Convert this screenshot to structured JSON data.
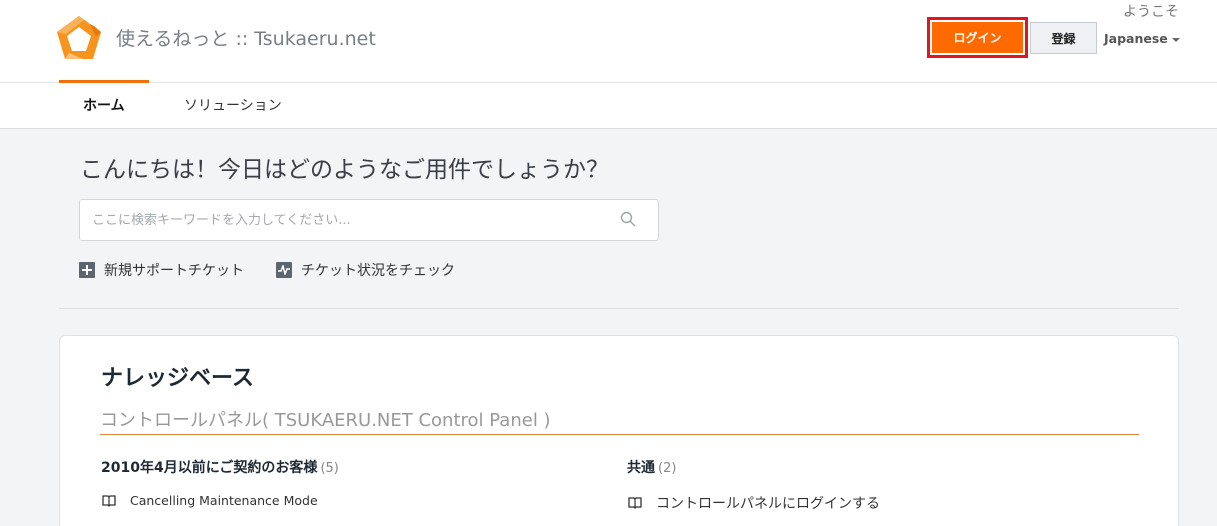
{
  "header": {
    "site_title": "使えるねっと :: Tsukaeru.net",
    "welcome": "ようこそ",
    "login_label": "ログイン",
    "register_label": "登録",
    "language": "Japanese"
  },
  "nav": {
    "items": [
      {
        "label": "ホーム",
        "active": true
      },
      {
        "label": "ソリューション",
        "active": false
      }
    ]
  },
  "hero": {
    "greeting": "こんにちは！今日はどのようなご用件でしょうか？",
    "search_placeholder": "ここに検索キーワードを入力してください...",
    "actions": [
      {
        "label": "新規サポートチケット",
        "icon": "plus-icon"
      },
      {
        "label": "チケット状況をチェック",
        "icon": "activity-icon"
      }
    ]
  },
  "knowledge_base": {
    "title": "ナレッジベース",
    "section_title": "コントロールパネル( TSUKAERU.NET Control Panel )",
    "categories": [
      {
        "name": "2010年4月以前にご契約のお客様",
        "count": "(5)",
        "articles": [
          "Cancelling Maintenance Mode"
        ]
      },
      {
        "name": "共通",
        "count": "(2)",
        "articles": [
          "コントロールパネルにログインする"
        ]
      }
    ]
  },
  "colors": {
    "accent": "#ff6a00",
    "highlight_border": "#e51420",
    "nav_active": "#f0700e"
  }
}
